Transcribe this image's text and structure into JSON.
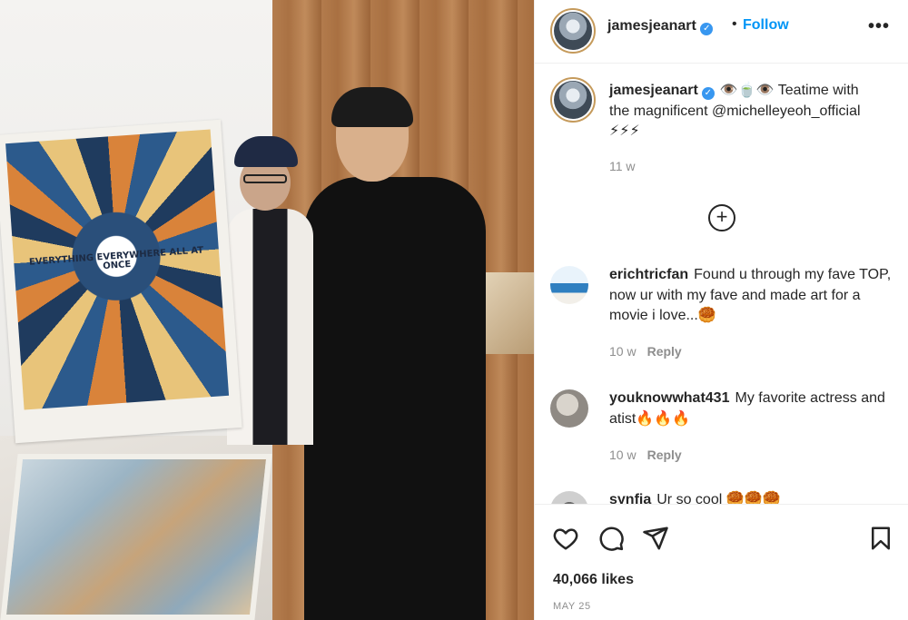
{
  "post": {
    "author": "jamesjeanart",
    "follow_label": "Follow",
    "separator": "•",
    "more_label": "•••",
    "verified_glyph": "✓",
    "photo": {
      "poster_title": "EVERYTHING EVERYWHERE ALL AT ONCE"
    }
  },
  "caption": {
    "username": "jamesjeanart",
    "text": "👁️🍵👁️ Teatime with the magnificent @michelleyeoh_official ⚡⚡⚡",
    "time": "11 w"
  },
  "load_more": {
    "glyph": "+"
  },
  "comments": [
    {
      "username": "erichtricfan",
      "text": "Found u through my fave TOP, now ur with my fave and made art for a movie i love...🥮",
      "time": "10 w",
      "reply_label": "Reply"
    },
    {
      "username": "youknowwhat431",
      "text": "My favorite actress and atist🔥🔥🔥",
      "time": "10 w",
      "reply_label": "Reply"
    },
    {
      "username": "synfia",
      "text": "Ur so cool 🥮🥮🥮",
      "time": "",
      "reply_label": ""
    }
  ],
  "actions": {
    "like_icon": "heart-icon",
    "comment_icon": "comment-icon",
    "share_icon": "paper-plane-icon",
    "save_icon": "bookmark-icon",
    "likes": "40,066 likes",
    "date": "MAY 25"
  },
  "colors": {
    "follow": "#0095f6",
    "verified": "#3897f0",
    "muted": "#8e8e8e",
    "text": "#262626"
  }
}
